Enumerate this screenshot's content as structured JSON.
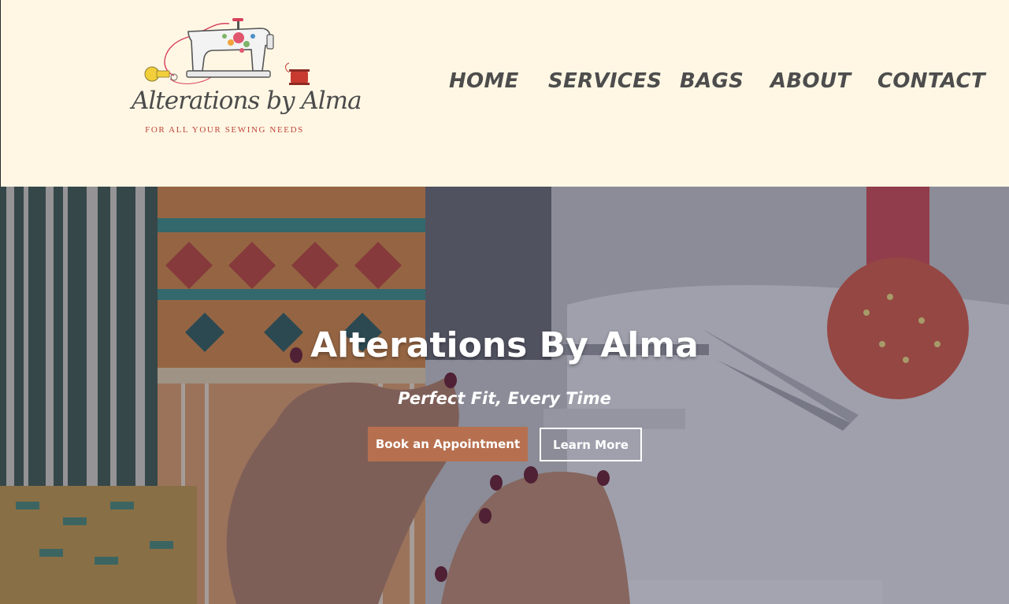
{
  "header": {
    "logo": {
      "script_text": "Alterations by Alma",
      "tagline": "FOR ALL YOUR SEWING NEEDS"
    },
    "nav": [
      {
        "label": "HOME"
      },
      {
        "label": "SERVICES"
      },
      {
        "label": "BAGS"
      },
      {
        "label": "ABOUT"
      },
      {
        "label": "CONTACT"
      }
    ]
  },
  "hero": {
    "title": "Alterations By Alma",
    "subtitle": "Perfect Fit, Every Time",
    "primary_button": "Book an Appointment",
    "secondary_button": "Learn More"
  },
  "colors": {
    "header_bg": "#fff7e4",
    "nav_text": "#4d4d4d",
    "primary_button": "#b7704f",
    "tagline": "#c0443a"
  }
}
